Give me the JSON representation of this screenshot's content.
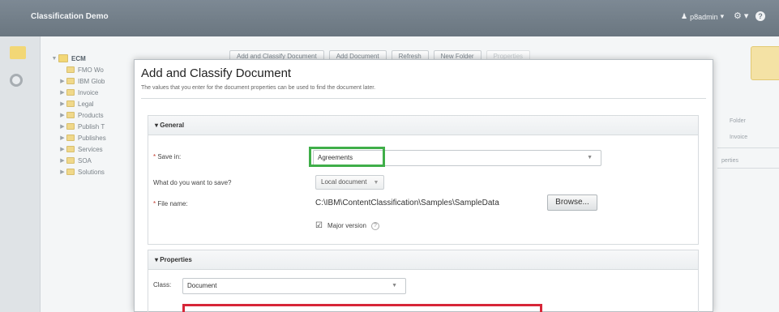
{
  "header": {
    "app_title": "Classification Demo",
    "user": "p8admin",
    "user_caret": "▾",
    "gear_menu": "⚙ ▾",
    "help": "?"
  },
  "tree": {
    "root": "ECM",
    "items": [
      "FMO Wo",
      "IBM Glob",
      "Invoice",
      "Legal",
      "Products",
      "Publish T",
      "Publishes",
      "Services",
      "SOA",
      "Solutions"
    ]
  },
  "toolbar": {
    "buttons": [
      "Add and Classify Document",
      "Add Document",
      "Refresh",
      "New Folder",
      "Properties"
    ]
  },
  "right_panel": {
    "labels": [
      "Folder",
      "Invoice",
      "perties"
    ]
  },
  "dialog": {
    "title": "Add and Classify Document",
    "subtitle": "The values that you enter for the document properties can be used to find the document later.",
    "general": {
      "header": "General",
      "save_in_label": "Save in:",
      "save_in_value": "Agreements",
      "what_label": "What do you want to save?",
      "what_value": "Local document",
      "file_name_label": "File name:",
      "file_name_value": "C:\\IBM\\ContentClassification\\Samples\\SampleData",
      "browse_label": "Browse...",
      "major_version_label": "Major version"
    },
    "properties": {
      "header": "Properties",
      "class_label": "Class:",
      "class_value": "Document"
    }
  },
  "colors": {
    "highlight_green": "#3fae49",
    "highlight_red": "#d72638",
    "header_bg": "#6a7680"
  }
}
